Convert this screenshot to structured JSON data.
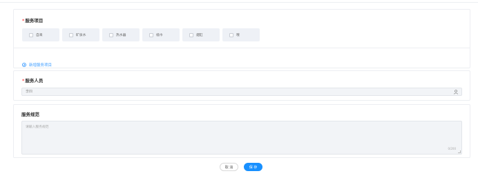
{
  "services": {
    "required_mark": "*",
    "title": "服务项目",
    "items": [
      {
        "label": "自来"
      },
      {
        "label": "矿泉水"
      },
      {
        "label": "热水器"
      },
      {
        "label": "纸巾"
      },
      {
        "label": "烟缸"
      },
      {
        "label": "哦"
      }
    ],
    "add_label": "新增服务项目"
  },
  "staff": {
    "required_mark": "*",
    "title": "服务人员",
    "value": "李四"
  },
  "norms": {
    "title": "服务规范",
    "placeholder": "请输入服务规范",
    "counter": "0/200"
  },
  "actions": {
    "cancel_label": "取 消",
    "save_label": "保 存"
  },
  "colors": {
    "accent": "#1890ff",
    "link": "#409eff",
    "required": "#ff4d4f"
  },
  "icons": {
    "add": "plus-circle-icon",
    "staff_picker": "user-icon"
  }
}
